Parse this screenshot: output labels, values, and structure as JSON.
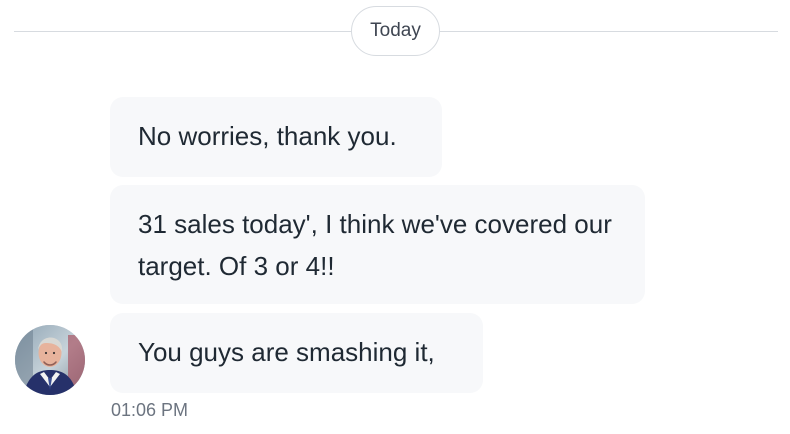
{
  "conversation": {
    "date_label": "Today",
    "messages": [
      {
        "text": "No worries, thank you."
      },
      {
        "text": "31 sales today', I think we've covered our target. Of 3 or 4!!"
      },
      {
        "text": "You guys are smashing it,"
      }
    ],
    "timestamp": "01:06 PM",
    "avatar": {
      "icon": "profile-photo-icon"
    }
  },
  "colors": {
    "background": "#ffffff",
    "bubble": "#f7f8fa",
    "divider": "#d7dbe0",
    "text": "#1f2933",
    "muted_text": "#6c7480"
  }
}
